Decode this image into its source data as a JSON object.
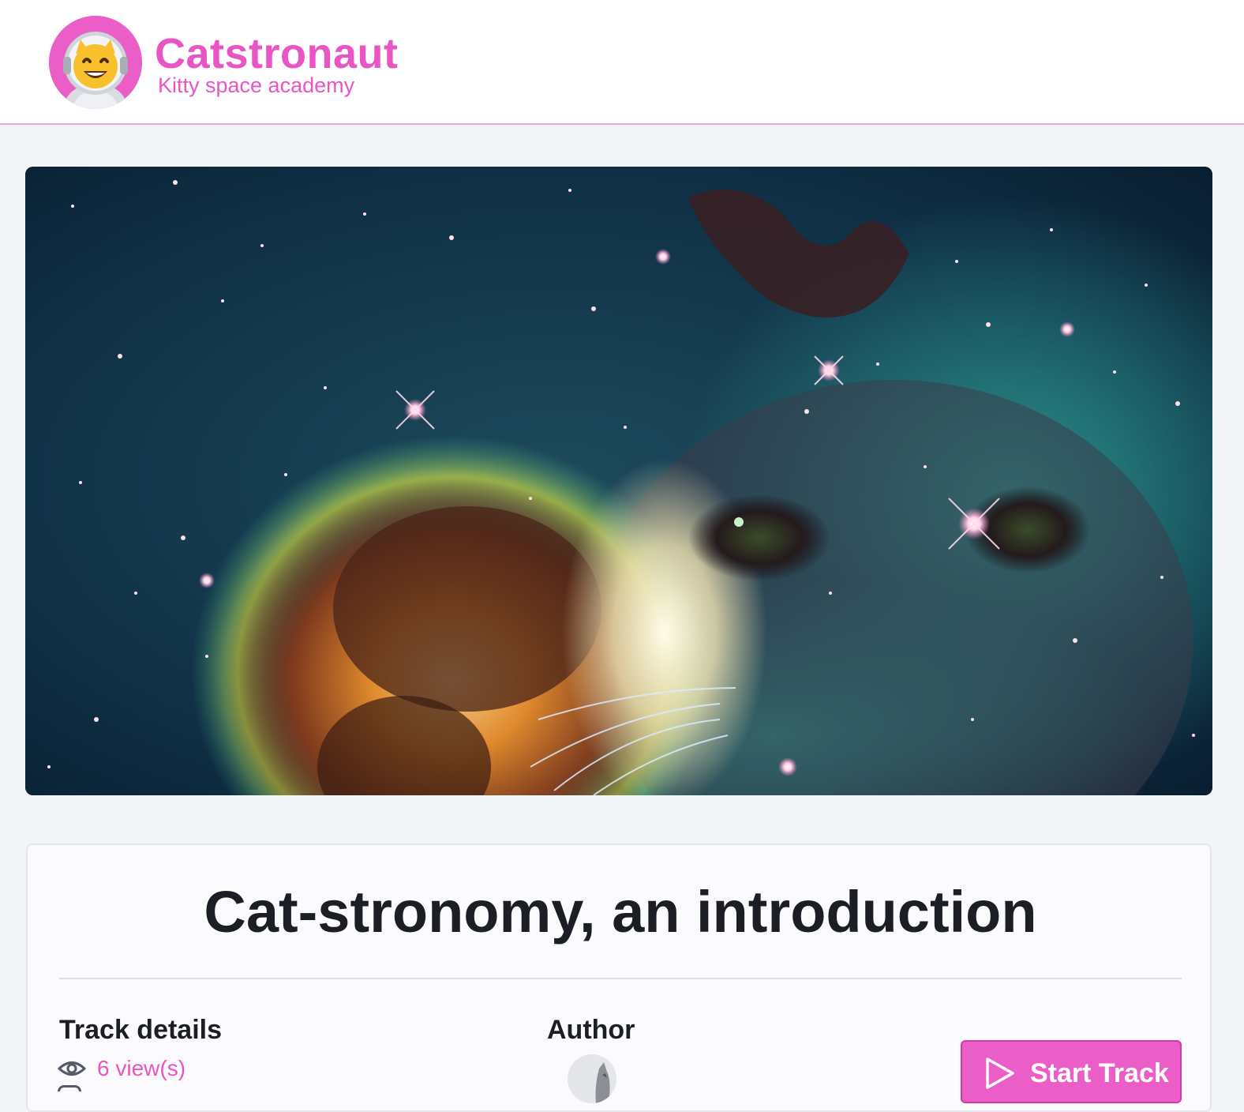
{
  "header": {
    "brand": "Catstronaut",
    "tagline": "Kitty space academy",
    "logo_icon": "astronaut-cat-emoji-icon",
    "accent_color": "#e955c4"
  },
  "hero": {
    "image": "space-nebula-cat-illustration"
  },
  "track": {
    "title": "Cat-stronomy, an introduction",
    "details_heading": "Track details",
    "views": "6 view(s)",
    "author_heading": "Author",
    "start_button": "Start Track"
  }
}
